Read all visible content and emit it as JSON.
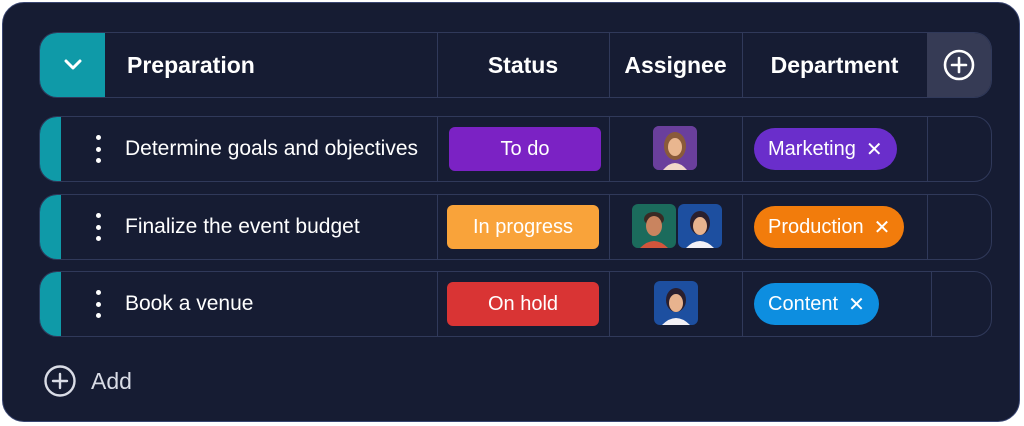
{
  "header": {
    "group_title": "Preparation",
    "columns": {
      "status": "Status",
      "assignee": "Assignee",
      "department": "Department"
    }
  },
  "rows": [
    {
      "task": "Determine goals and objectives",
      "status": {
        "label": "To do",
        "color": "#7b22c4"
      },
      "assignees": [
        "avatar-woman-brown-hair"
      ],
      "department": {
        "label": "Marketing",
        "color": "#6a2ecb"
      }
    },
    {
      "task": "Finalize the event budget",
      "status": {
        "label": "In progress",
        "color": "#f9a33a"
      },
      "assignees": [
        "avatar-man-dark-hair",
        "avatar-woman-dark-hair"
      ],
      "department": {
        "label": "Production",
        "color": "#f27c0c"
      }
    },
    {
      "task": "Book a venue",
      "status": {
        "label": "On hold",
        "color": "#d93434"
      },
      "assignees": [
        "avatar-woman-dark-hair"
      ],
      "department": {
        "label": "Content",
        "color": "#0d8ee0"
      }
    }
  ],
  "footer": {
    "add_label": "Add"
  },
  "icons": {
    "collapse": "chevron-down-icon",
    "add_column": "plus-circle-icon",
    "remove_tag": "close-icon",
    "row_menu": "kebab-icon",
    "add_row": "plus-circle-icon"
  },
  "colors": {
    "background": "#161c33",
    "accent": "#0f9aa8"
  }
}
